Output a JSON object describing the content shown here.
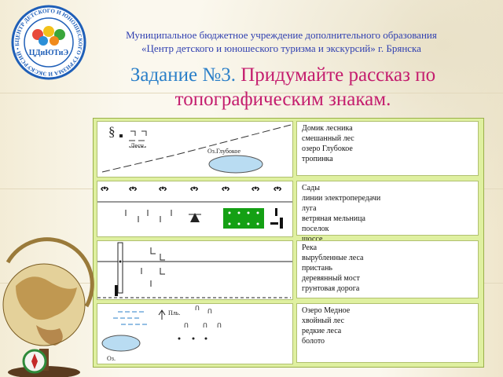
{
  "org": {
    "line1": "Муниципальное бюджетное учреждение дополнительного образования",
    "line2": "«Центр детского и юношеского туризма и экскурсий» г. Брянска"
  },
  "logo": {
    "ring_text": "ЦЕНТР ДЕТСКОГО И ЮНОШЕСКОГО ТУРИЗМА И ЭКСКУРСИЙ • БРЯНСК •",
    "center_text": "ЦДиЮТиЭ"
  },
  "task": {
    "number": "Задание №3",
    "dot": ".",
    "text": "Придумайте рассказ по топографическим  знакам."
  },
  "rows": [
    {
      "map_labels": [
        "Лесн.",
        "Оз.Глубокое"
      ],
      "items": [
        "Домик лесника",
        "смешанный лес",
        "озеро Глубокое",
        "тропинка"
      ]
    },
    {
      "map_labels": [],
      "items": [
        "Сады",
        "линии электропередачи",
        "луга",
        "ветряная мельница",
        "поселок",
        "шоссе"
      ]
    },
    {
      "map_labels": [],
      "items": [
        "Река",
        "вырубленные леса",
        "пристань",
        "деревянный мост",
        "грунтовая дорога"
      ]
    },
    {
      "map_labels": [
        "Пль.",
        "Оз."
      ],
      "items": [
        "Озеро Медное",
        "хвойный лес",
        "редкие леса",
        "болото"
      ]
    }
  ],
  "colors": {
    "org_text": "#2f3fb0",
    "task_number": "#2a7fc8",
    "task_text": "#c41d6e",
    "panel_bg": "#dff0a0",
    "lake": "#b9dcf2",
    "settlement": "#14a014"
  }
}
